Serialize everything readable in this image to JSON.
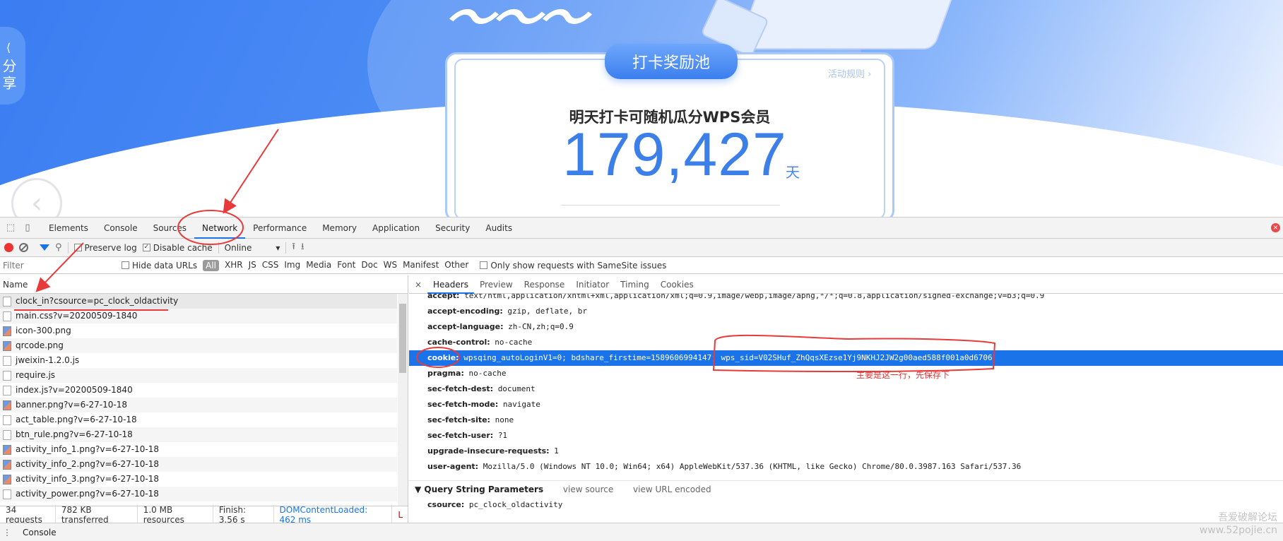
{
  "hero": {
    "share_label": "分享",
    "pool_title": "打卡奖励池",
    "rules_link": "活动规则 ›",
    "card_heading": "明天打卡可随机瓜分WPS会员",
    "big_number": "179,427",
    "unit": "天"
  },
  "devtools": {
    "tabs": [
      "Elements",
      "Console",
      "Sources",
      "Network",
      "Performance",
      "Memory",
      "Application",
      "Security",
      "Audits"
    ],
    "active_tab": "Network",
    "toolbar": {
      "preserve_log": "Preserve log",
      "disable_cache": "Disable cache",
      "throttle": "Online"
    },
    "filter": {
      "placeholder": "Filter",
      "hide_data_urls": "Hide data URLs",
      "types": [
        "All",
        "XHR",
        "JS",
        "CSS",
        "Img",
        "Media",
        "Font",
        "Doc",
        "WS",
        "Manifest",
        "Other"
      ],
      "samesite": "Only show requests with SameSite issues"
    },
    "name_header": "Name",
    "requests": [
      {
        "name": "clock_in?csource=pc_clock_oldactivity",
        "icon": "doc"
      },
      {
        "name": "main.css?v=20200509-1840",
        "icon": "doc"
      },
      {
        "name": "icon-300.png",
        "icon": "img"
      },
      {
        "name": "qrcode.png",
        "icon": "img"
      },
      {
        "name": "jweixin-1.2.0.js",
        "icon": "doc"
      },
      {
        "name": "require.js",
        "icon": "doc"
      },
      {
        "name": "index.js?v=20200509-1840",
        "icon": "doc"
      },
      {
        "name": "banner.png?v=6-27-10-18",
        "icon": "img"
      },
      {
        "name": "act_table.png?v=6-27-10-18",
        "icon": "doc"
      },
      {
        "name": "btn_rule.png?v=6-27-10-18",
        "icon": "doc"
      },
      {
        "name": "activity_info_1.png?v=6-27-10-18",
        "icon": "img"
      },
      {
        "name": "activity_info_2.png?v=6-27-10-18",
        "icon": "img"
      },
      {
        "name": "activity_info_3.png?v=6-27-10-18",
        "icon": "img"
      },
      {
        "name": "activity_power.png?v=6-27-10-18",
        "icon": "doc"
      }
    ],
    "status": {
      "requests": "34 requests",
      "transferred": "782 KB transferred",
      "resources": "1.0 MB resources",
      "finish": "Finish: 3.56 s",
      "dcl": "DOMContentLoaded: 462 ms",
      "load": "L"
    },
    "detail_tabs": [
      "Headers",
      "Preview",
      "Response",
      "Initiator",
      "Timing",
      "Cookies"
    ],
    "headers": [
      {
        "k": "accept:",
        "v": "text/html,application/xhtml+xml,application/xml;q=0.9,image/webp,image/apng,*/*;q=0.8,application/signed-exchange;v=b3;q=0.9"
      },
      {
        "k": "accept-encoding:",
        "v": "gzip, deflate, br"
      },
      {
        "k": "accept-language:",
        "v": "zh-CN,zh;q=0.9"
      },
      {
        "k": "cache-control:",
        "v": "no-cache"
      },
      {
        "k": "cookie:",
        "v": "wpsqing_autoLoginV1=0; bdshare_firstime=1589606994147; wps_sid=V02SHuf_ZhQqsXEzse1Yj9NKHJ2JW2g00aed588f001a0d6706"
      },
      {
        "k": "pragma:",
        "v": "no-cache"
      },
      {
        "k": "sec-fetch-dest:",
        "v": "document"
      },
      {
        "k": "sec-fetch-mode:",
        "v": "navigate"
      },
      {
        "k": "sec-fetch-site:",
        "v": "none"
      },
      {
        "k": "sec-fetch-user:",
        "v": "?1"
      },
      {
        "k": "upgrade-insecure-requests:",
        "v": "1"
      },
      {
        "k": "user-agent:",
        "v": "Mozilla/5.0 (Windows NT 10.0; Win64; x64) AppleWebKit/537.36 (KHTML, like Gecko) Chrome/80.0.3987.163 Safari/537.36"
      }
    ],
    "annotation_note": "主要是这一行，先保存下",
    "query_section": {
      "title": "▼ Query String Parameters",
      "view_source": "view source",
      "view_encoded": "view URL encoded",
      "param_key": "csource:",
      "param_value": "pc_clock_oldactivity"
    },
    "drawer_tab": "Console"
  },
  "watermark": {
    "line1": "吾爱破解论坛",
    "line2": "www.52pojie.cn"
  }
}
